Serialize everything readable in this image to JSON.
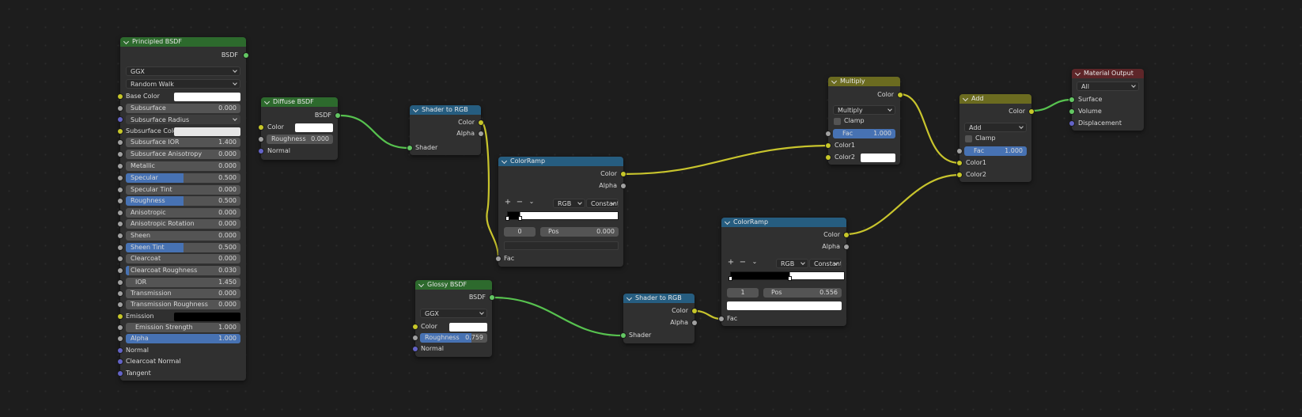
{
  "nodes": {
    "principled": {
      "title": "Principled BSDF",
      "output": "BSDF",
      "distribution": "GGX",
      "subsurface_method": "Random Walk",
      "base_color_label": "Base Color",
      "subsurface_label": "Subsurface",
      "subsurface_value": "0.000",
      "subsurface_radius_label": "Subsurface Radius",
      "subsurface_color_label": "Subsurface Color",
      "subsurface_ior_label": "Subsurface IOR",
      "subsurface_ior_value": "1.400",
      "subsurface_aniso_label": "Subsurface Anisotropy",
      "subsurface_aniso_value": "0.000",
      "metallic_label": "Metallic",
      "metallic_value": "0.000",
      "specular_label": "Specular",
      "specular_value": "0.500",
      "specular_tint_label": "Specular Tint",
      "specular_tint_value": "0.000",
      "roughness_label": "Roughness",
      "roughness_value": "0.500",
      "anisotropic_label": "Anisotropic",
      "anisotropic_value": "0.000",
      "aniso_rot_label": "Anisotropic Rotation",
      "aniso_rot_value": "0.000",
      "sheen_label": "Sheen",
      "sheen_value": "0.000",
      "sheen_tint_label": "Sheen Tint",
      "sheen_tint_value": "0.500",
      "clearcoat_label": "Clearcoat",
      "clearcoat_value": "0.000",
      "clearcoat_rough_label": "Clearcoat Roughness",
      "clearcoat_rough_value": "0.030",
      "ior_label": "IOR",
      "ior_value": "1.450",
      "transmission_label": "Transmission",
      "transmission_value": "0.000",
      "trans_rough_label": "Transmission Roughness",
      "trans_rough_value": "0.000",
      "emission_label": "Emission",
      "emission_strength_label": "Emission Strength",
      "emission_strength_value": "1.000",
      "alpha_label": "Alpha",
      "alpha_value": "1.000",
      "normal_label": "Normal",
      "clearcoat_normal_label": "Clearcoat Normal",
      "tangent_label": "Tangent"
    },
    "diffuse": {
      "title": "Diffuse BSDF",
      "output": "BSDF",
      "color_label": "Color",
      "roughness_label": "Roughness",
      "roughness_value": "0.000",
      "normal_label": "Normal"
    },
    "shader_to_rgb_1": {
      "title": "Shader to RGB",
      "out_color": "Color",
      "out_alpha": "Alpha",
      "in_shader": "Shader"
    },
    "colorramp_1": {
      "title": "ColorRamp",
      "out_color": "Color",
      "out_alpha": "Alpha",
      "color_mode": "RGB",
      "interpolation": "Constant",
      "stop_index": "0",
      "pos_label": "Pos",
      "pos_value": "0.000",
      "in_fac": "Fac"
    },
    "glossy": {
      "title": "Glossy BSDF",
      "output": "BSDF",
      "distribution": "GGX",
      "color_label": "Color",
      "roughness_label": "Roughness",
      "roughness_value": "0.759",
      "normal_label": "Normal"
    },
    "shader_to_rgb_2": {
      "title": "Shader to RGB",
      "out_color": "Color",
      "out_alpha": "Alpha",
      "in_shader": "Shader"
    },
    "colorramp_2": {
      "title": "ColorRamp",
      "out_color": "Color",
      "out_alpha": "Alpha",
      "color_mode": "RGB",
      "interpolation": "Constant",
      "stop_index": "1",
      "pos_label": "Pos",
      "pos_value": "0.556",
      "in_fac": "Fac"
    },
    "multiply": {
      "title": "Multiply",
      "out_color": "Color",
      "blend_mode": "Multiply",
      "clamp_label": "Clamp",
      "fac_label": "Fac",
      "fac_value": "1.000",
      "color1_label": "Color1",
      "color2_label": "Color2"
    },
    "add": {
      "title": "Add",
      "out_color": "Color",
      "blend_mode": "Add",
      "clamp_label": "Clamp",
      "fac_label": "Fac",
      "fac_value": "1.000",
      "color1_label": "Color1",
      "color2_label": "Color2"
    },
    "material_output": {
      "title": "Material Output",
      "target": "All",
      "surface_label": "Surface",
      "volume_label": "Volume",
      "displacement_label": "Displacement"
    }
  },
  "colors": {
    "link_shader": "#57c24f",
    "link_color": "#c8c42d",
    "field_highlight": "#4772b3"
  }
}
